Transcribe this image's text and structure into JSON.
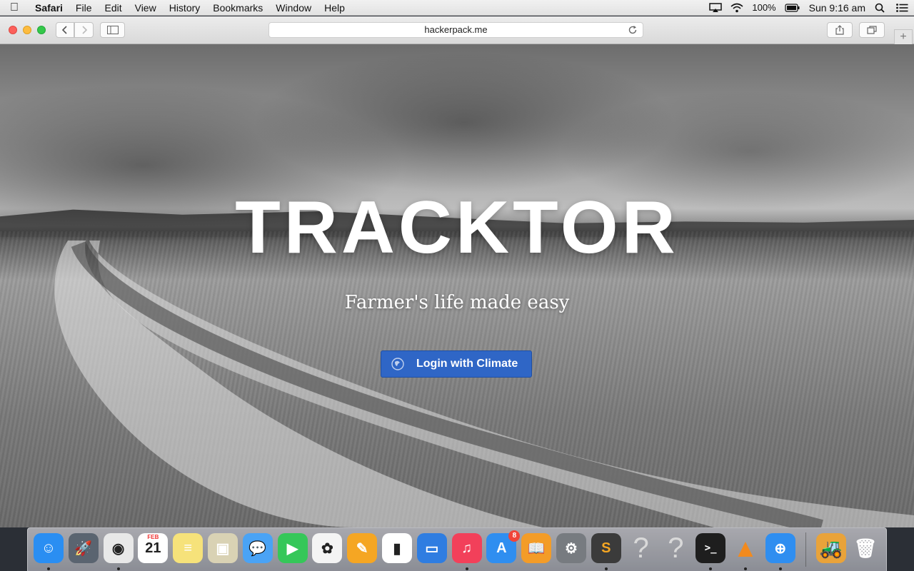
{
  "menubar": {
    "app_name": "Safari",
    "menus": [
      "File",
      "Edit",
      "View",
      "History",
      "Bookmarks",
      "Window",
      "Help"
    ],
    "battery": "100%",
    "clock": "Sun 9:16 am"
  },
  "browser": {
    "url": "hackerpack.me"
  },
  "hero": {
    "title": "TRACKTOR",
    "tagline": "Farmer's life made easy",
    "login_label": "Login with Climate",
    "login_color": "#2f66c6"
  },
  "dock": {
    "apps": [
      {
        "name": "Finder",
        "icon": "finder-icon",
        "color": "#2a8ef2",
        "glyph": "☺",
        "running": true
      },
      {
        "name": "Launchpad",
        "icon": "launchpad-icon",
        "color": "#5a6470",
        "glyph": "🚀",
        "running": false
      },
      {
        "name": "Chrome",
        "icon": "chrome-icon",
        "color": "#e8e8e8",
        "glyph": "◉",
        "running": true
      },
      {
        "name": "Calendar",
        "icon": "calendar-icon",
        "color": "#ffffff",
        "glyph": "21",
        "label_top": "FEB",
        "running": false
      },
      {
        "name": "Notes",
        "icon": "notes-icon",
        "color": "#f6e27a",
        "glyph": "≡",
        "running": false
      },
      {
        "name": "Preview",
        "icon": "preview-icon",
        "color": "#d9d2b4",
        "glyph": "▣",
        "running": false
      },
      {
        "name": "Messages",
        "icon": "messages-icon",
        "color": "#4aa3f5",
        "glyph": "💬",
        "running": false
      },
      {
        "name": "FaceTime",
        "icon": "facetime-icon",
        "color": "#35c759",
        "glyph": "▶",
        "running": false
      },
      {
        "name": "Photos",
        "icon": "photos-icon",
        "color": "#f4f4f4",
        "glyph": "✿",
        "running": false
      },
      {
        "name": "Pages",
        "icon": "pages-icon",
        "color": "#f5a623",
        "glyph": "✎",
        "running": false
      },
      {
        "name": "Numbers",
        "icon": "numbers-icon",
        "color": "#ffffff",
        "glyph": "▮",
        "running": false
      },
      {
        "name": "Keynote",
        "icon": "keynote-icon",
        "color": "#2f7de1",
        "glyph": "▭",
        "running": false
      },
      {
        "name": "iTunes",
        "icon": "itunes-icon",
        "color": "#f2405a",
        "glyph": "♫",
        "running": true
      },
      {
        "name": "App Store",
        "icon": "app-store-icon",
        "color": "#2f8ef0",
        "glyph": "A",
        "badge": "8",
        "running": false
      },
      {
        "name": "iBooks",
        "icon": "ibooks-icon",
        "color": "#f39c28",
        "glyph": "📖",
        "running": false
      },
      {
        "name": "System Preferences",
        "icon": "system-preferences-icon",
        "color": "#777b80",
        "glyph": "⚙",
        "running": false
      },
      {
        "name": "Sublime Text",
        "icon": "sublime-text-icon",
        "color": "#3b3b3b",
        "glyph": "S",
        "running": true
      },
      {
        "name": "Unknown",
        "icon": "question-mark-icon",
        "color": "transparent",
        "glyph": "?",
        "running": false
      },
      {
        "name": "Unknown",
        "icon": "question-mark-icon",
        "color": "transparent",
        "glyph": "?",
        "running": false
      },
      {
        "name": "Terminal",
        "icon": "terminal-icon",
        "color": "#1e1e1e",
        "glyph": ">_",
        "running": true
      },
      {
        "name": "VLC",
        "icon": "vlc-icon",
        "color": "transparent",
        "glyph": "▲",
        "running": true
      },
      {
        "name": "Safari",
        "icon": "safari-icon",
        "color": "#2f8ef0",
        "glyph": "⊕",
        "running": true
      }
    ],
    "right_items": [
      {
        "name": "Downloads",
        "icon": "downloads-stack-icon",
        "color": "#e9a33a",
        "glyph": "🚜"
      },
      {
        "name": "Trash",
        "icon": "trash-icon",
        "color": "transparent",
        "glyph": "🗑"
      }
    ]
  }
}
